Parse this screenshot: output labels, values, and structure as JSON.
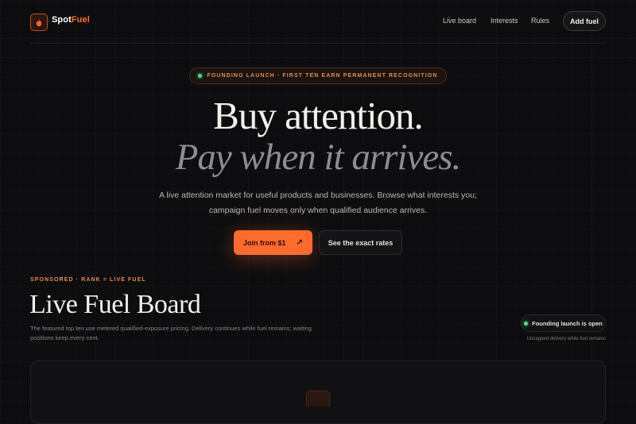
{
  "header": {
    "brand_part1": "Spot",
    "brand_part2": "Fuel",
    "nav": [
      "Live board",
      "Interests",
      "Rules"
    ],
    "add_fuel": "Add fuel"
  },
  "badge": {
    "text": "FOUNDING LAUNCH · FIRST TEN EARN PERMANENT RECOGNITION"
  },
  "hero": {
    "title_line1": "Buy attention.",
    "title_line2": "Pay when it arrives.",
    "description": "A live attention market for useful products and businesses. Browse what interests you; campaign fuel moves only when qualified audience arrives.",
    "cta_primary": "Join from $1",
    "cta_primary_arrow": "↗",
    "cta_secondary": "See the exact rates"
  },
  "board": {
    "kicker": "SPONSORED · RANK = LIVE FUEL",
    "title": "Live Fuel Board",
    "description": "The featured top ten use metered qualified-exposure pricing. Delivery continues while fuel remains; waiting positions keep every cent.",
    "status": "Founding launch is open",
    "status_note": "Uncapped delivery while fuel remains"
  },
  "colors": {
    "accent": "#ff6b2c",
    "status_green": "#4ade80",
    "background": "#0d0d0f"
  }
}
